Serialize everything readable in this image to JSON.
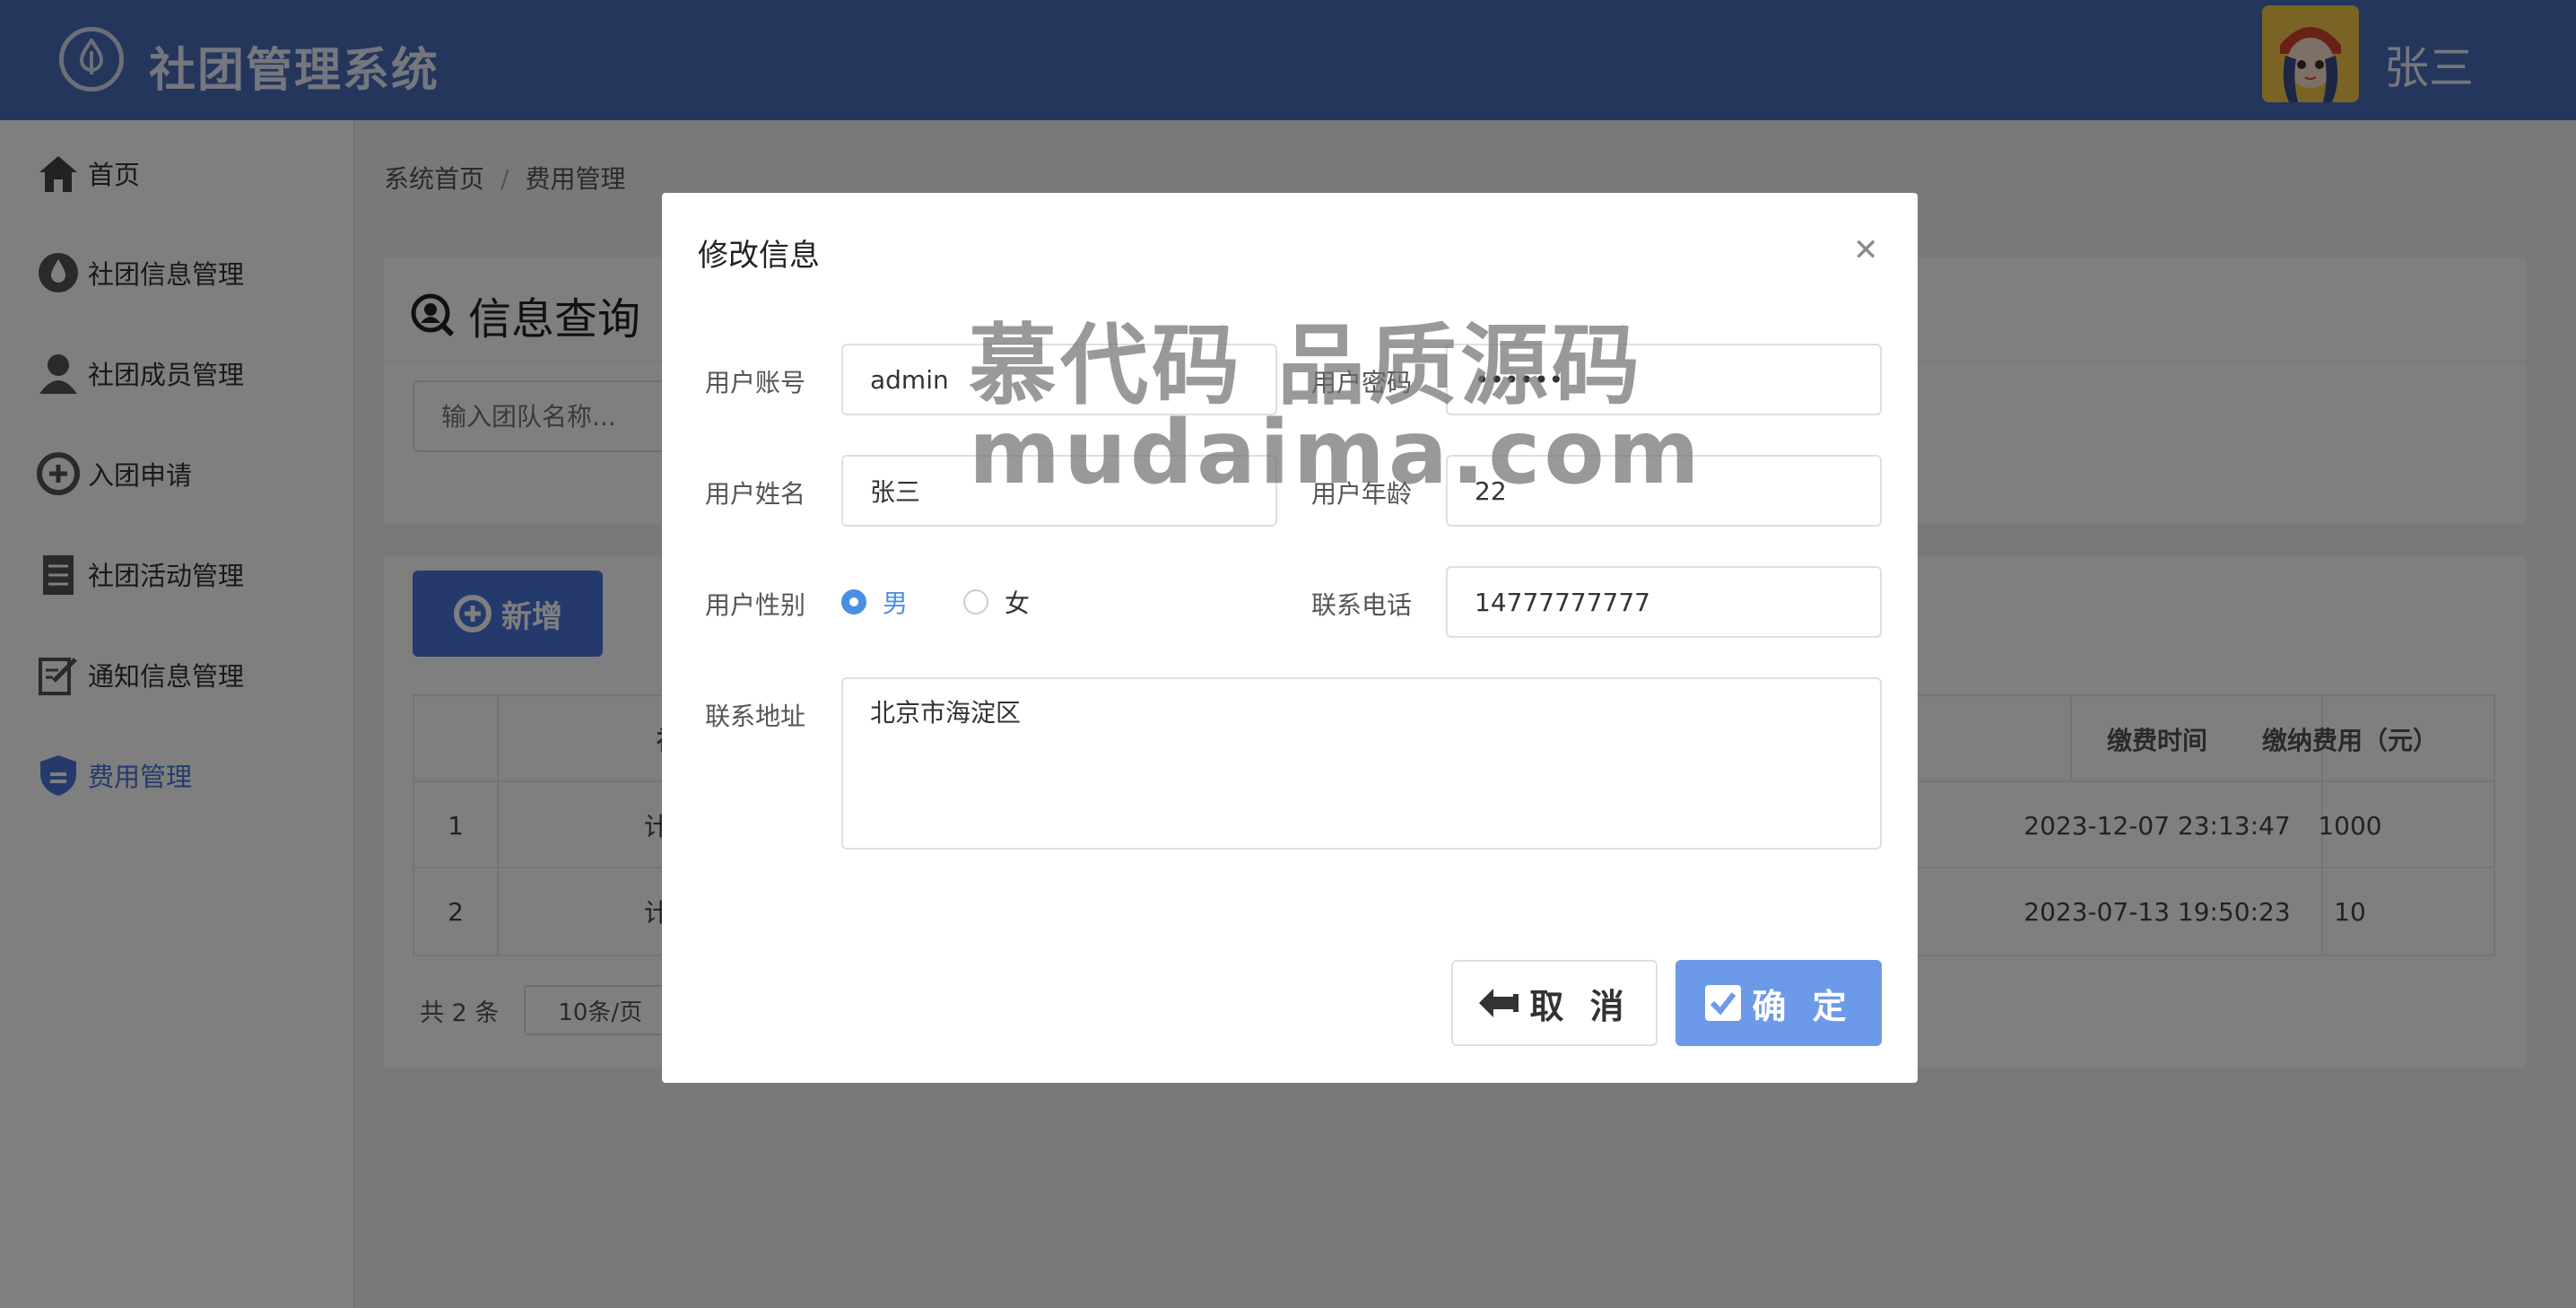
{
  "header": {
    "app_title": "社团管理系统",
    "user_name": "张三"
  },
  "sidebar": {
    "items": [
      {
        "label": "首页",
        "icon": "home-icon"
      },
      {
        "label": "社团信息管理",
        "icon": "drop-icon"
      },
      {
        "label": "社团成员管理",
        "icon": "user-icon"
      },
      {
        "label": "入团申请",
        "icon": "plus-circle-icon"
      },
      {
        "label": "社团活动管理",
        "icon": "document-icon"
      },
      {
        "label": "通知信息管理",
        "icon": "edit-icon"
      },
      {
        "label": "费用管理",
        "icon": "shield-icon",
        "active": true
      }
    ]
  },
  "breadcrumb": {
    "home": "系统首页",
    "current": "费用管理"
  },
  "query": {
    "title": "信息查询",
    "search_placeholder": "输入团队名称..."
  },
  "toolbar": {
    "add_label": "新增"
  },
  "table": {
    "headers": [
      "社团",
      "缴费时间",
      "缴纳费用（元）"
    ],
    "rows": [
      {
        "index": "1",
        "club": "计算机",
        "time": "2023-12-07 23:13:47",
        "fee": "1000"
      },
      {
        "index": "2",
        "club": "计算机",
        "time": "2023-07-13 19:50:23",
        "fee": "10"
      }
    ]
  },
  "pagination": {
    "total_text": "共 2 条",
    "page_size": "10条/页"
  },
  "dialog": {
    "title": "修改信息",
    "fields": {
      "account_label": "用户账号",
      "account_value": "admin",
      "password_label": "用户密码",
      "password_value": "••••••",
      "name_label": "用户姓名",
      "name_value": "张三",
      "age_label": "用户年龄",
      "age_value": "22",
      "gender_label": "用户性别",
      "gender_male": "男",
      "gender_female": "女",
      "phone_label": "联系电话",
      "phone_value": "14777777777",
      "address_label": "联系地址",
      "address_value": "北京市海淀区"
    },
    "cancel_label": "取 消",
    "ok_label": "确 定"
  },
  "watermark": {
    "line1": "慕代码 品质源码",
    "line2": "mudaima.com"
  },
  "colors": {
    "header": "#4a6cb8",
    "accent": "#4a74d8",
    "ok_button": "#6d9ae8"
  }
}
